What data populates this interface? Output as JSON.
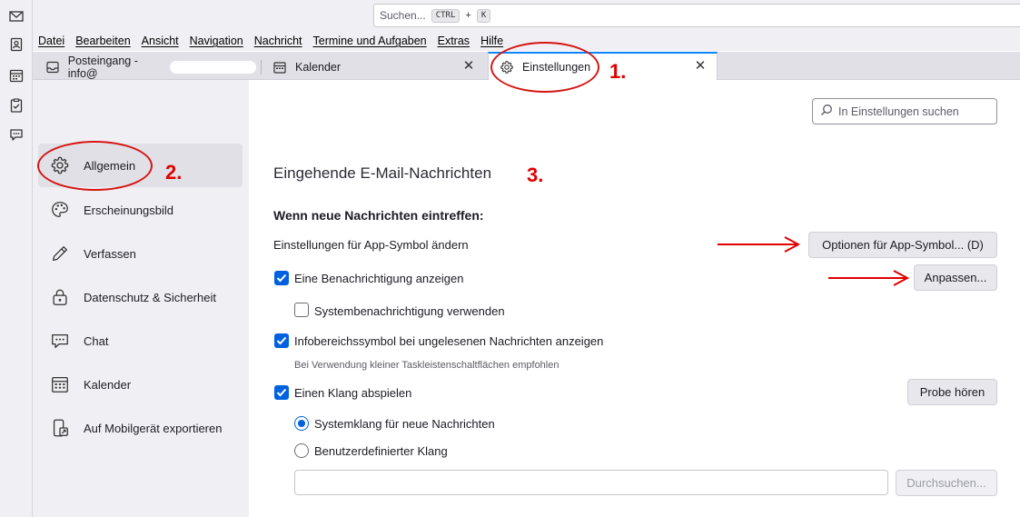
{
  "search": {
    "placeholder": "Suchen...",
    "key1": "CTRL",
    "plus": "+",
    "key2": "K"
  },
  "menu": [
    "Datei",
    "Bearbeiten",
    "Ansicht",
    "Navigation",
    "Nachricht",
    "Termine und Aufgaben",
    "Extras",
    "Hilfe"
  ],
  "tabs": [
    {
      "label": "Posteingang - info@",
      "icon": "inbox-icon"
    },
    {
      "label": "Kalender",
      "icon": "calendar-icon"
    },
    {
      "label": "Einstellungen",
      "icon": "gear-icon"
    }
  ],
  "spaces": [
    "mail-icon",
    "address-book-icon",
    "calendar-icon",
    "tasks-icon",
    "chat-icon"
  ],
  "sidebar": {
    "items": [
      {
        "label": "Allgemein",
        "icon": "gear-icon"
      },
      {
        "label": "Erscheinungsbild",
        "icon": "palette-icon"
      },
      {
        "label": "Verfassen",
        "icon": "pencil-icon"
      },
      {
        "label": "Datenschutz & Sicherheit",
        "icon": "lock-icon"
      },
      {
        "label": "Chat",
        "icon": "chat-icon"
      },
      {
        "label": "Kalender",
        "icon": "calendar-icon"
      },
      {
        "label": "Auf Mobilgerät exportieren",
        "icon": "mobile-export-icon"
      }
    ]
  },
  "main": {
    "settings_search_placeholder": "In Einstellungen suchen",
    "section_title": "Eingehende E-Mail-Nachrichten",
    "subsection_title": "Wenn neue Nachrichten eintreffen:",
    "app_icon_label": "Einstellungen für App-Symbol ändern",
    "app_icon_button": "Optionen für App-Symbol... (D)",
    "show_notification": {
      "label": "Eine Benachrichtigung anzeigen",
      "checked": true
    },
    "customize_button": "Anpassen...",
    "system_notification": {
      "label": "Systembenachrichtigung verwenden",
      "checked": false
    },
    "tray_icon": {
      "label": "Infobereichssymbol bei ungelesenen Nachrichten anzeigen",
      "checked": true
    },
    "tray_icon_hint": "Bei Verwendung kleiner Taskleistenschaltflächen empfohlen",
    "play_sound": {
      "label": "Einen Klang abspielen",
      "checked": true
    },
    "preview_button": "Probe hören",
    "sound_system": {
      "label": "Systemklang für neue Nachrichten",
      "selected": true
    },
    "sound_custom": {
      "label": "Benutzerdefinierter Klang",
      "selected": false
    },
    "custom_sound_path": "",
    "browse_button": "Durchsuchen..."
  },
  "annotations": {
    "step1": "1.",
    "step2": "2.",
    "step3": "3."
  },
  "colors": {
    "accent": "#0061e0",
    "annotation": "#e00000",
    "active_tab_border": "#0a84ff"
  }
}
